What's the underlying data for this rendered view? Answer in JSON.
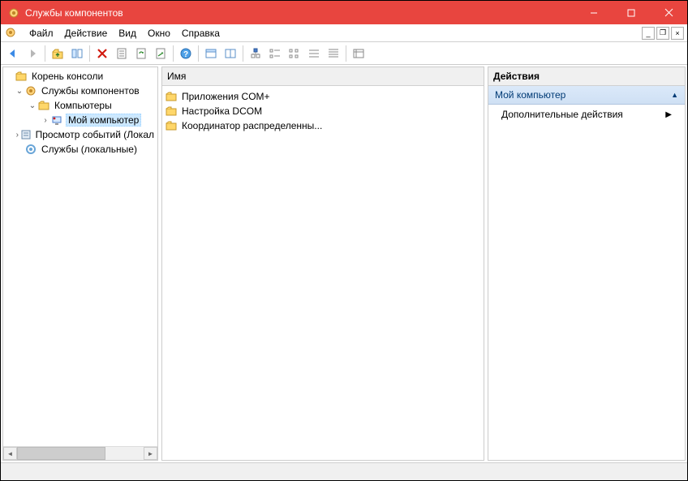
{
  "titlebar": {
    "title": "Службы компонентов"
  },
  "menu": {
    "file": "Файл",
    "action": "Действие",
    "view": "Вид",
    "window": "Окно",
    "help": "Справка"
  },
  "toolbar_icons": {
    "back": "back-arrow",
    "forward": "forward-arrow",
    "up_folder": "up-folder",
    "show_hide_tree": "tree-toggle",
    "delete": "delete",
    "properties": "properties",
    "refresh": "refresh",
    "export_list": "export-list",
    "help": "help",
    "show_console_tree": "show-tree",
    "tile": "tile",
    "details": "details",
    "list_view": "list",
    "large_icons": "icons",
    "small_icons": "small-icons",
    "view1": "view1",
    "view2": "view2",
    "view3": "view3"
  },
  "tree": {
    "root": "Корень консоли",
    "component_services": "Службы компонентов",
    "computers": "Компьютеры",
    "my_computer": "Мой компьютер",
    "event_viewer": "Просмотр событий (Локал",
    "services_local": "Службы (локальные)"
  },
  "list": {
    "header": "Имя",
    "items": [
      "Приложения COM+",
      "Настройка DCOM",
      "Координатор распределенны..."
    ]
  },
  "actions": {
    "header": "Действия",
    "section": "Мой компьютер",
    "more_actions": "Дополнительные действия"
  },
  "colors": {
    "titlebar_bg": "#e8453f",
    "selection_bg": "#cce8ff",
    "underline": "#d11a0f"
  }
}
